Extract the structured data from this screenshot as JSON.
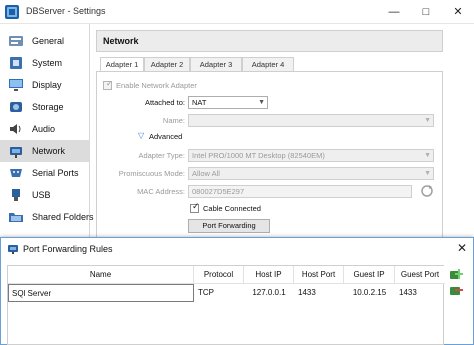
{
  "window": {
    "title": "DBServer - Settings"
  },
  "sidebar": {
    "items": [
      {
        "label": "General",
        "icon": "general-icon",
        "selected": false
      },
      {
        "label": "System",
        "icon": "system-icon",
        "selected": false
      },
      {
        "label": "Display",
        "icon": "display-icon",
        "selected": false
      },
      {
        "label": "Storage",
        "icon": "storage-icon",
        "selected": false
      },
      {
        "label": "Audio",
        "icon": "audio-icon",
        "selected": false
      },
      {
        "label": "Network",
        "icon": "network-icon",
        "selected": true
      },
      {
        "label": "Serial Ports",
        "icon": "serial-ports-icon",
        "selected": false
      },
      {
        "label": "USB",
        "icon": "usb-icon",
        "selected": false
      },
      {
        "label": "Shared Folders",
        "icon": "shared-folders-icon",
        "selected": false
      }
    ]
  },
  "section_title": "Network",
  "tabs": [
    "Adapter 1",
    "Adapter 2",
    "Adapter 3",
    "Adapter 4"
  ],
  "adapter": {
    "enable_label": "Enable Network Adapter",
    "attached_label": "Attached to:",
    "attached_value": "NAT",
    "name_label": "Name:",
    "advanced_label": "Advanced",
    "adapter_type_label": "Adapter Type:",
    "adapter_type_value": "Intel PRO/1000 MT Desktop (82540EM)",
    "promiscuous_label": "Promiscuous Mode:",
    "promiscuous_value": "Allow All",
    "mac_label": "MAC Address:",
    "mac_value": "080027D5E297",
    "cable_label": "Cable Connected",
    "port_forwarding_button": "Port Forwarding"
  },
  "port_forwarding": {
    "title": "Port Forwarding Rules",
    "columns": [
      "Name",
      "Protocol",
      "Host IP",
      "Host Port",
      "Guest IP",
      "Guest Port"
    ],
    "rows": [
      [
        "SQl Server",
        "TCP",
        "127.0.0.1",
        "1433",
        "10.0.2.15",
        "1433"
      ]
    ]
  },
  "colors": {
    "accent": "#3c7fd1",
    "selected_bg": "#dcdcdc"
  }
}
